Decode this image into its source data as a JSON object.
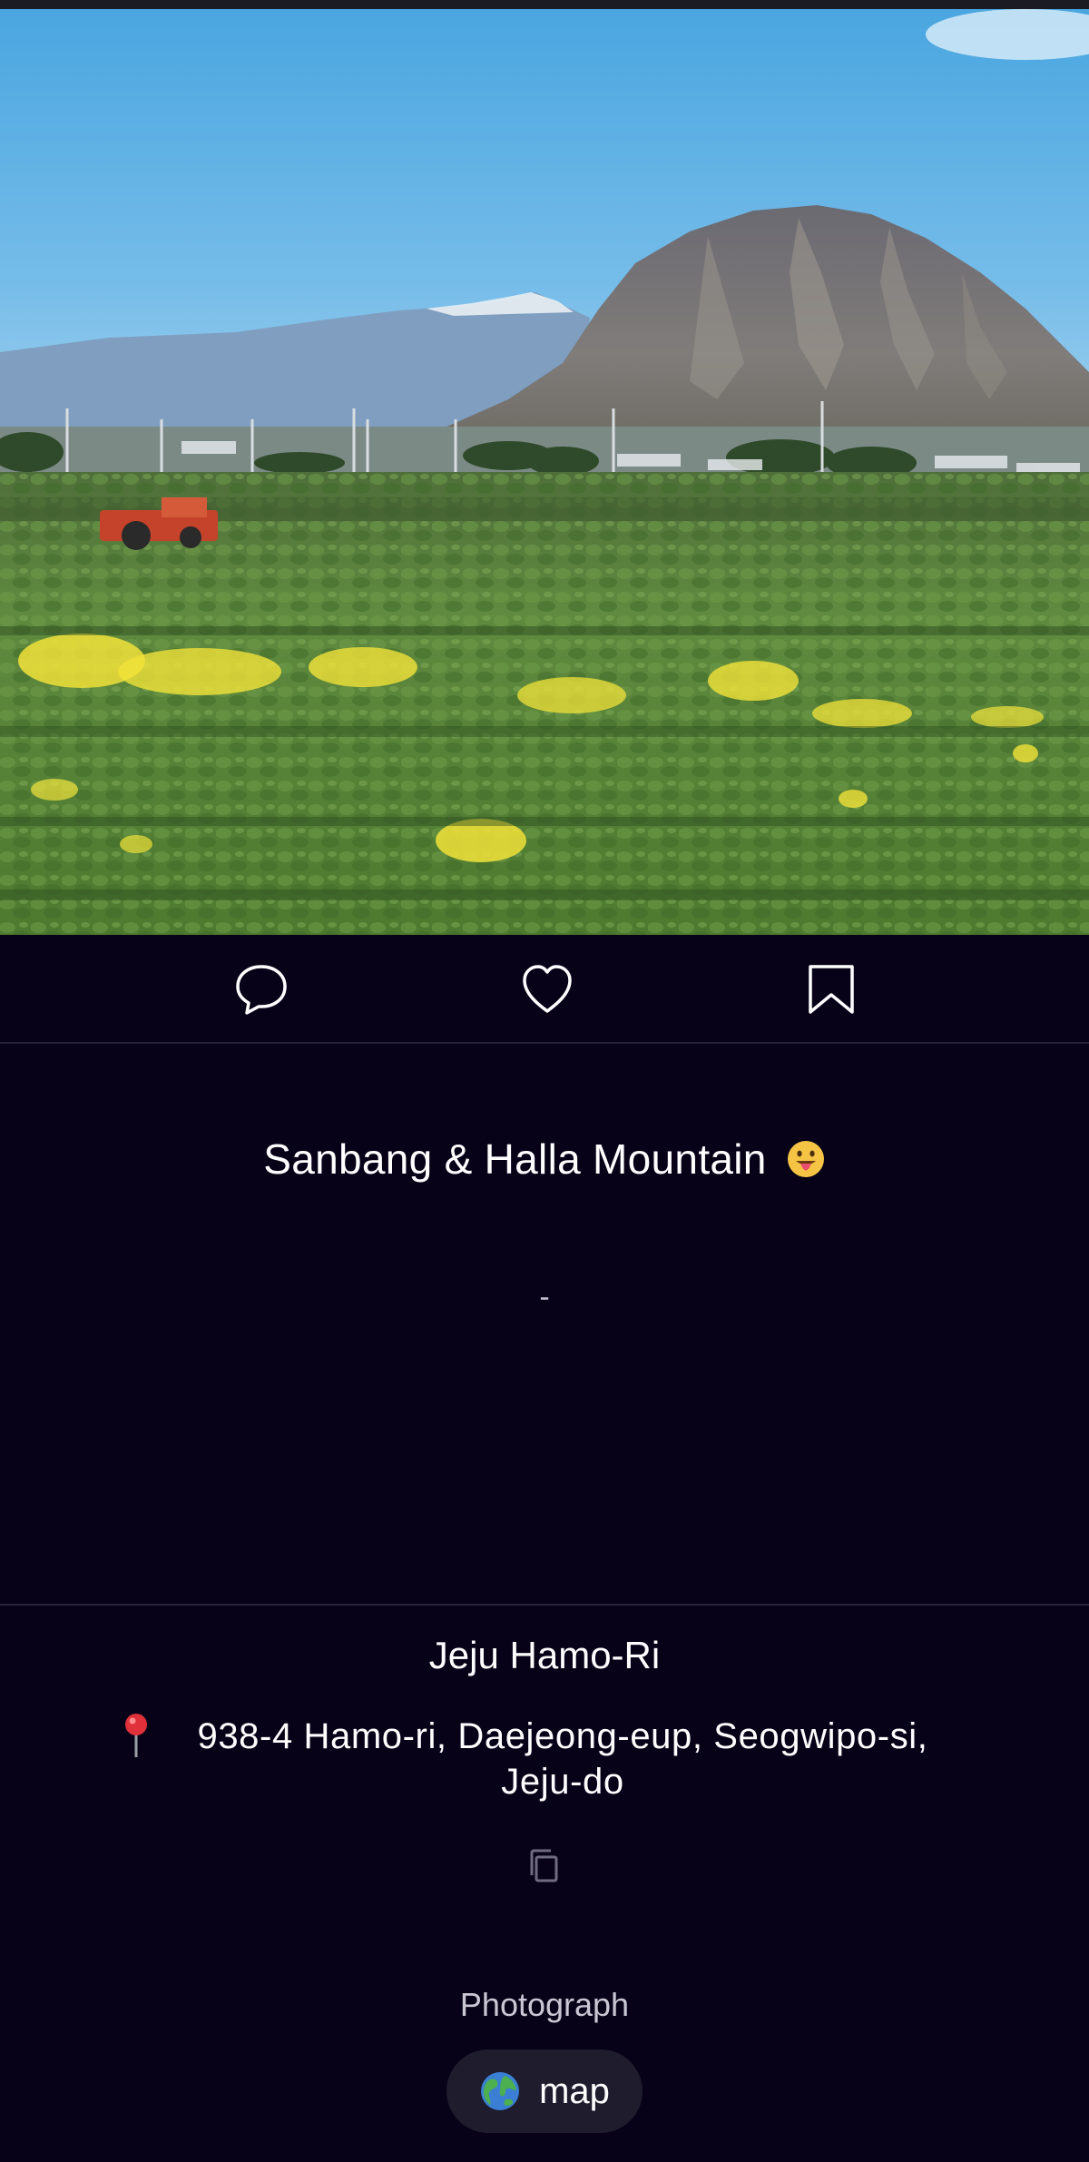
{
  "post": {
    "title": "Sanbang & Halla Mountain",
    "title_emoji": "face-with-tongue",
    "description": "-"
  },
  "actions": {
    "comment_icon": "speech-bubble-icon",
    "like_icon": "heart-icon",
    "bookmark_icon": "bookmark-icon"
  },
  "location": {
    "name": "Jeju Hamo-Ri",
    "pin_icon": "round-pushpin-icon",
    "address_line1": "938-4 Hamo-ri, Daejeong-eup, Seogwipo-si,",
    "address_line2": "Jeju-do",
    "copy_icon": "copy-icon"
  },
  "category": "Photograph",
  "map_chip": {
    "icon": "globe-icon",
    "label": "map"
  },
  "colors": {
    "background": "#070218",
    "divider": "#25223a",
    "chip_background": "#1f1c2e",
    "text_primary": "#ffffff",
    "text_muted": "#c9c7d4"
  }
}
